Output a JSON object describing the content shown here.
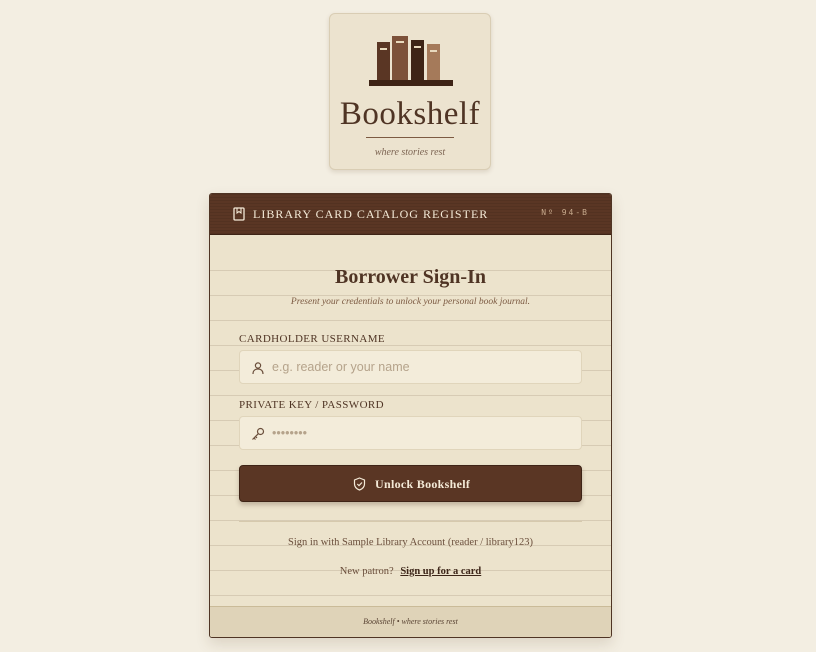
{
  "brand": {
    "name": "Bookshelf",
    "tagline": "where stories rest",
    "logo_icon": "books-icon"
  },
  "register": {
    "title": "LIBRARY CARD CATALOG REGISTER",
    "code": "Nº 94-B",
    "icon": "bookmark-icon",
    "header_color": "#5a3624"
  },
  "signin": {
    "title": "Borrower Sign-In",
    "subtitle": "Present your credentials to unlock your personal book journal."
  },
  "username": {
    "label": "CARDHOLDER USERNAME",
    "placeholder": "e.g. reader or your name",
    "value": "",
    "icon": "user-icon"
  },
  "password": {
    "label": "PRIVATE KEY / PASSWORD",
    "placeholder": "••••••••",
    "value": "",
    "icon": "key-icon"
  },
  "submit": {
    "label": "Unlock Bookshelf",
    "icon": "shield-check-icon"
  },
  "sample_account": "Sign in with Sample Library Account (reader / library123)",
  "signup": {
    "prompt": "New patron?",
    "link": "Sign up for a card"
  },
  "footer": "Bookshelf • where stories rest",
  "colors": {
    "background": "#f3eee2",
    "card": "#ece3cc",
    "accent": "#5a3624",
    "text": "#4f3424"
  }
}
